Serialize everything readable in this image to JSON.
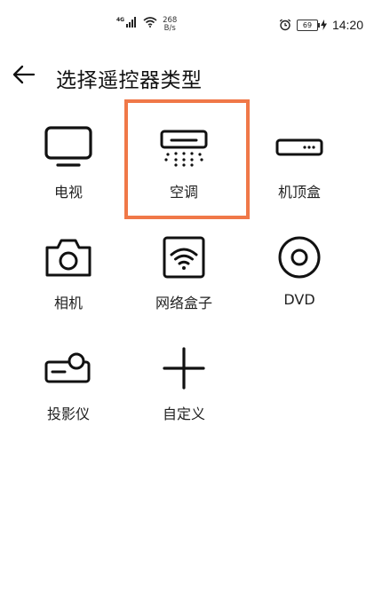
{
  "status_bar": {
    "network_type": "4G",
    "speed_value": "268",
    "speed_unit": "B/s",
    "battery": "69",
    "time": "14:20",
    "alarm_icon": "alarm-clock-icon",
    "charging_icon": "bolt-icon"
  },
  "header": {
    "title": "选择遥控器类型",
    "back_icon": "arrow-left-icon"
  },
  "devices": [
    {
      "label": "电视",
      "icon": "tv-icon"
    },
    {
      "label": "空调",
      "icon": "air-conditioner-icon",
      "selected": true
    },
    {
      "label": "机顶盒",
      "icon": "set-top-box-icon"
    },
    {
      "label": "相机",
      "icon": "camera-icon"
    },
    {
      "label": "网络盒子",
      "icon": "wifi-box-icon"
    },
    {
      "label": "DVD",
      "icon": "disc-icon"
    },
    {
      "label": "投影仪",
      "icon": "projector-icon"
    },
    {
      "label": "自定义",
      "icon": "plus-icon"
    }
  ],
  "colors": {
    "highlight": "#f07848",
    "text": "#1a1a1a",
    "background": "#ffffff"
  }
}
